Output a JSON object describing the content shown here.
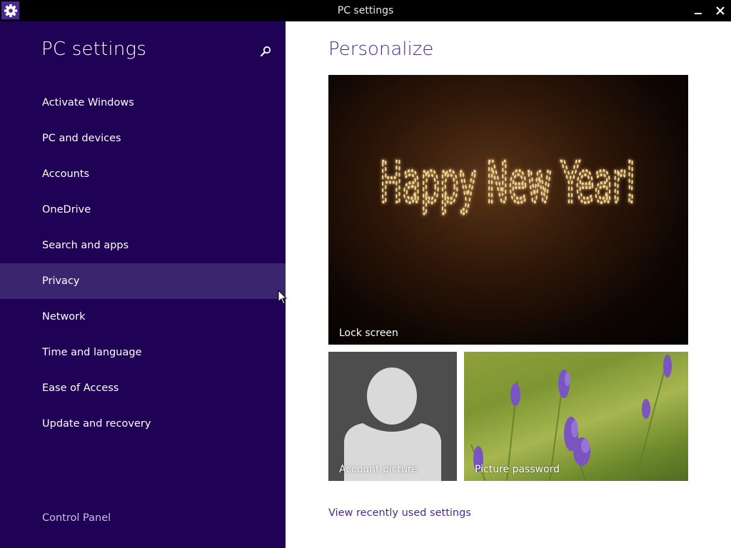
{
  "window": {
    "title": "PC settings",
    "app_icon": "gear-icon",
    "minimize_icon": "minimize-icon",
    "close_icon": "close-icon"
  },
  "sidebar": {
    "title": "PC settings",
    "search_icon": "search-icon",
    "items": [
      {
        "label": "Activate Windows"
      },
      {
        "label": "PC and devices"
      },
      {
        "label": "Accounts"
      },
      {
        "label": "OneDrive"
      },
      {
        "label": "Search and apps"
      },
      {
        "label": "Privacy",
        "state": "hover"
      },
      {
        "label": "Network"
      },
      {
        "label": "Time and language"
      },
      {
        "label": "Ease of Access"
      },
      {
        "label": "Update and recovery"
      }
    ],
    "footer_link": "Control Panel"
  },
  "main": {
    "title": "Personalize",
    "tiles": {
      "lock_screen": {
        "label": "Lock screen",
        "image_text": "Happy New Year!"
      },
      "account_picture": {
        "label": "Account picture"
      },
      "picture_password": {
        "label": "Picture password"
      }
    },
    "recent_link": "View recently used settings"
  },
  "colors": {
    "sidebar_bg": "#1f0256",
    "sidebar_hover": "#3b2570",
    "accent": "#4b2a90",
    "titlebar_bg": "#000000"
  }
}
